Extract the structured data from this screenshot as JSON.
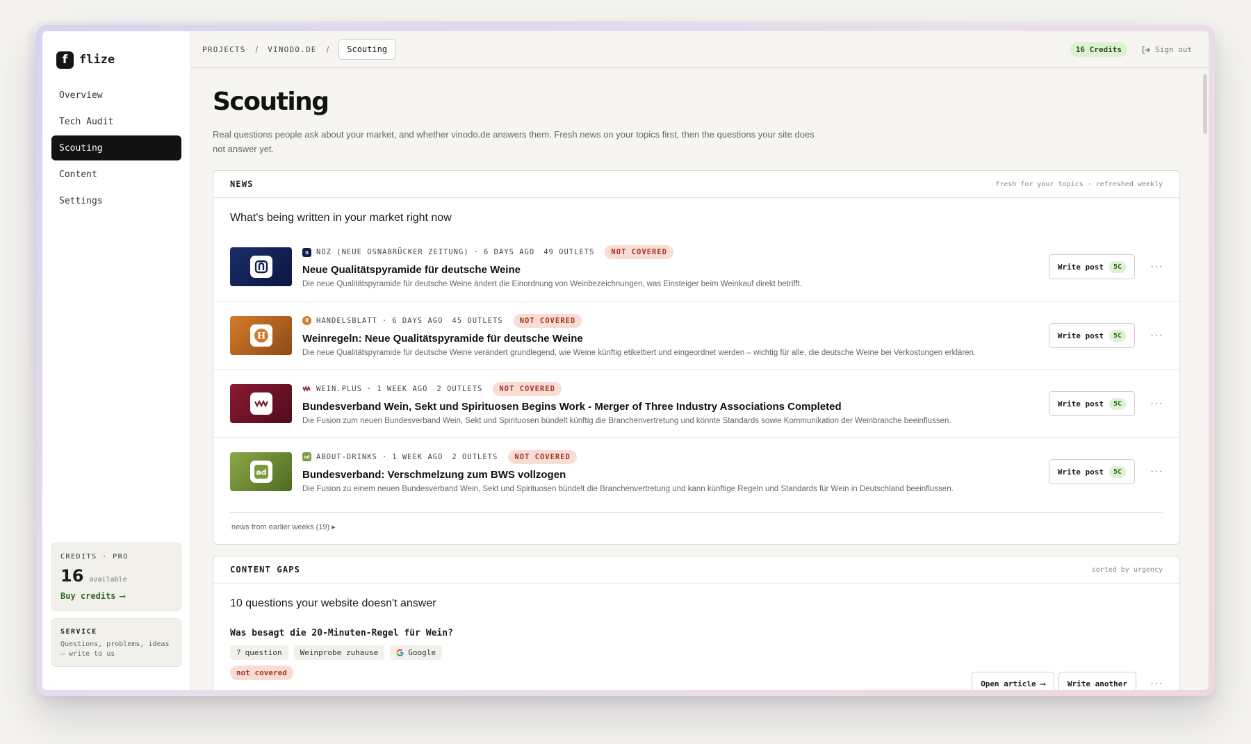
{
  "app": {
    "logo_letter": "f",
    "name": "flize"
  },
  "sidebar": {
    "items": [
      {
        "label": "Overview",
        "active": false
      },
      {
        "label": "Tech Audit",
        "active": false
      },
      {
        "label": "Scouting",
        "active": true
      },
      {
        "label": "Content",
        "active": false
      },
      {
        "label": "Settings",
        "active": false
      }
    ],
    "credits": {
      "label": "CREDITS · PRO",
      "count": "16",
      "available": "available",
      "buy_label": "Buy credits",
      "buy_arrow": "⟶"
    },
    "service": {
      "title": "SERVICE",
      "text": "Questions, problems, ideas — write to us"
    }
  },
  "topbar": {
    "breadcrumb": [
      "PROJECTS",
      "VINODO.DE"
    ],
    "separator": "/",
    "current": "Scouting",
    "credits_pill": "16 Credits",
    "signout": "Sign out"
  },
  "page": {
    "title": "Scouting",
    "description": "Real questions people ask about your market, and whether vinodo.de answers them. Fresh news on your topics first, then the questions your site does not answer yet."
  },
  "news": {
    "title": "NEWS",
    "meta": "fresh for your topics · refreshed weekly",
    "subtitle": "What's being written in your market right now",
    "items": [
      {
        "source": "NOZ (NEUE OSNABRÜCKER ZEITUNG)",
        "age": "6 DAYS AGO",
        "outlets": "49 OUTLETS",
        "status": "NOT COVERED",
        "title": "Neue Qualitätspyramide für deutsche Weine",
        "desc": "Die neue Qualitätspyramide für deutsche Weine ändert die Einordnung von Weinbezeichnungen, was Einsteiger beim Weinkauf direkt betrifft.",
        "thumb_color": "#0f1f4f",
        "thumb_glyph": "n",
        "glyph_color": "#0f1f4f"
      },
      {
        "source": "HANDELSBLATT",
        "age": "6 DAYS AGO",
        "outlets": "45 OUTLETS",
        "status": "NOT COVERED",
        "title": "Weinregeln: Neue Qualitätspyramide für deutsche Weine",
        "desc": "Die neue Qualitätspyramide für deutsche Weine verändert grundlegend, wie Weine künftig etikettiert und eingeordnet werden – wichtig für alle, die deutsche Weine bei Verkostungen erklären.",
        "thumb_color": "#b3631f",
        "thumb_glyph": "H",
        "glyph_color": "#d07a2c"
      },
      {
        "source": "WEIN.PLUS",
        "age": "1 WEEK AGO",
        "outlets": "2 OUTLETS",
        "status": "NOT COVERED",
        "title": "Bundesverband Wein, Sekt und Spirituosen Begins Work - Merger of Three Industry Associations Completed",
        "desc": "Die Fusion zum neuen Bundesverband Wein, Sekt und Spirituosen bündelt künftig die Branchenvertretung und könnte Standards sowie Kommunikation der Weinbranche beeinflussen.",
        "thumb_color": "#6e1226",
        "thumb_glyph": "᳹",
        "glyph_color": "#7a1a2e"
      },
      {
        "source": "ABOUT-DRINKS",
        "age": "1 WEEK AGO",
        "outlets": "2 OUTLETS",
        "status": "NOT COVERED",
        "title": "Bundesverband: Verschmelzung zum BWS vollzogen",
        "desc": "Die Fusion zu einem neuen Bundesverband Wein, Sekt und Spirituosen bündelt die Branchenvertretung und kann künftige Regeln und Standards für Wein in Deutschland beeinflussen.",
        "thumb_color": "#6e8a33",
        "thumb_glyph": "ad",
        "glyph_color": "#7d9a3c"
      }
    ],
    "write_label": "Write post",
    "cost": "5C",
    "more": "···",
    "earlier": "news from earlier weeks (19) ▸"
  },
  "gaps": {
    "title": "CONTENT GAPS",
    "meta": "sorted by urgency",
    "subtitle": "10 questions your website doesn't answer",
    "question": "Was besagt die 20-Minuten-Regel für Wein?",
    "tags": {
      "type": "question",
      "type_icon": "?",
      "topic": "Weinprobe zuhause",
      "engine": "Google"
    },
    "status": "not covered",
    "open_label": "Open article ⟶",
    "write_label": "Write another",
    "more": "···"
  },
  "colors": {
    "accent_dark": "#121212",
    "credit_green": "#2e6b22",
    "not_covered_red": "#a83222"
  }
}
